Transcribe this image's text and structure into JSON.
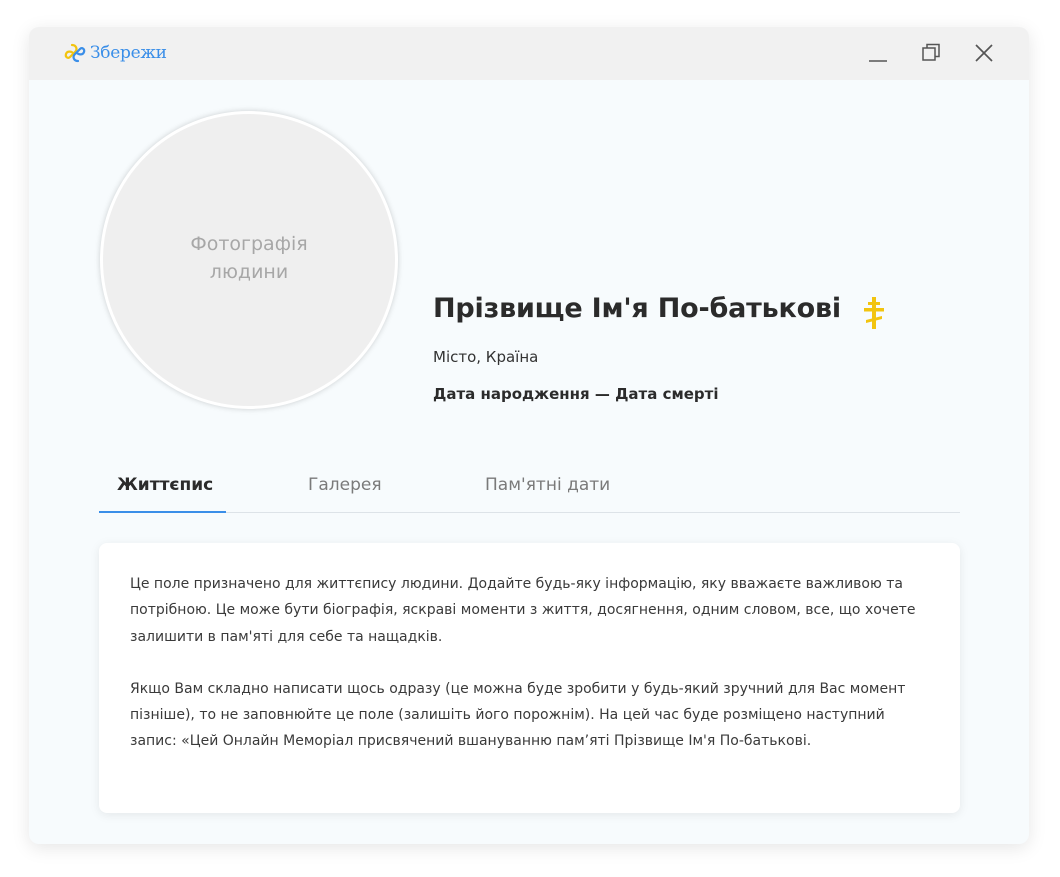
{
  "app": {
    "name": "Збережи",
    "brand_color": "#3a8ee8",
    "logo_icon": "interlocking-heart-logo-icon"
  },
  "window_controls": {
    "minimize_icon": "minimize-icon",
    "maximize_icon": "restore-icon",
    "close_icon": "close-icon"
  },
  "profile": {
    "photo_placeholder": "Фотографія людини",
    "full_name": "Прізвище Ім'я По-батькові",
    "religion_icon": "orthodox-cross-icon",
    "religion_icon_color": "#f2c40f",
    "location": "Місто, Країна",
    "dates": "Дата народження — Дата смерті"
  },
  "tabs": [
    {
      "label": "Життєпис",
      "active": true
    },
    {
      "label": "Галерея",
      "active": false
    },
    {
      "label": "Пам'ятні дати",
      "active": false
    }
  ],
  "biography": {
    "paragraphs": [
      "Це поле призначено для життєпису людини. Додайте будь-яку інформацію, яку вважаєте важливою та потрібною. Це може бути біографія, яскраві моменти з життя, досягнення, одним словом, все, що хочете залишити в пам'яті для себе та нащадків.",
      "Якщо Вам складно написати щось одразу (це можна буде зробити у будь-який зручний для Вас момент пізніше), то не заповнюйте це поле (залишіть його порожнім). На цей час буде розміщено наступний запис: «Цей Онлайн Меморіал присвячений вшануванню пам’яті Прізвище Ім'я По-батькові."
    ]
  }
}
